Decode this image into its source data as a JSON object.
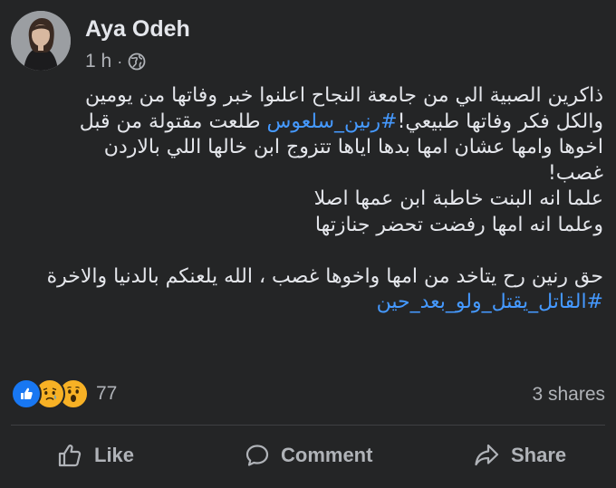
{
  "post": {
    "author": "Aya Odeh",
    "time": "1 h",
    "separator": "·",
    "audience_icon": "globe-icon",
    "text_lines": [
      "ذاكرين الصبية الي من جامعة النجاح اعلنوا خبر وفاتها من يومين",
      "طلعت مقتولة من قبل",
      "#رنين_سلعوس",
      "والكل فكر وفاتها طبيعي!",
      "اخوها وامها عشان امها بدها اياها تتزوج ابن خالها اللي بالاردن",
      "غصب!",
      "علما انه البنت خاطبة ابن عمها اصلا",
      "وعلما انه امها رفضت تحضر جنازتها",
      "حق رنين رح يتاخد من امها واخوها غصب ، الله يلعنكم بالدنيا والاخرة",
      "#القاتل_يقتل_ولو_بعد_حين"
    ]
  },
  "stats": {
    "reaction_icons": [
      "like-icon",
      "sad-icon",
      "wow-icon"
    ],
    "reaction_count": "77",
    "shares": "3 shares"
  },
  "actions": {
    "like": "Like",
    "comment": "Comment",
    "share": "Share"
  },
  "colors": {
    "background": "#242526",
    "text": "#e4e6eb",
    "secondary_text": "#b0b3b8",
    "hashtag": "#4599ff",
    "like_blue": "#1877f2",
    "reaction_yellow": "#f7b125"
  }
}
